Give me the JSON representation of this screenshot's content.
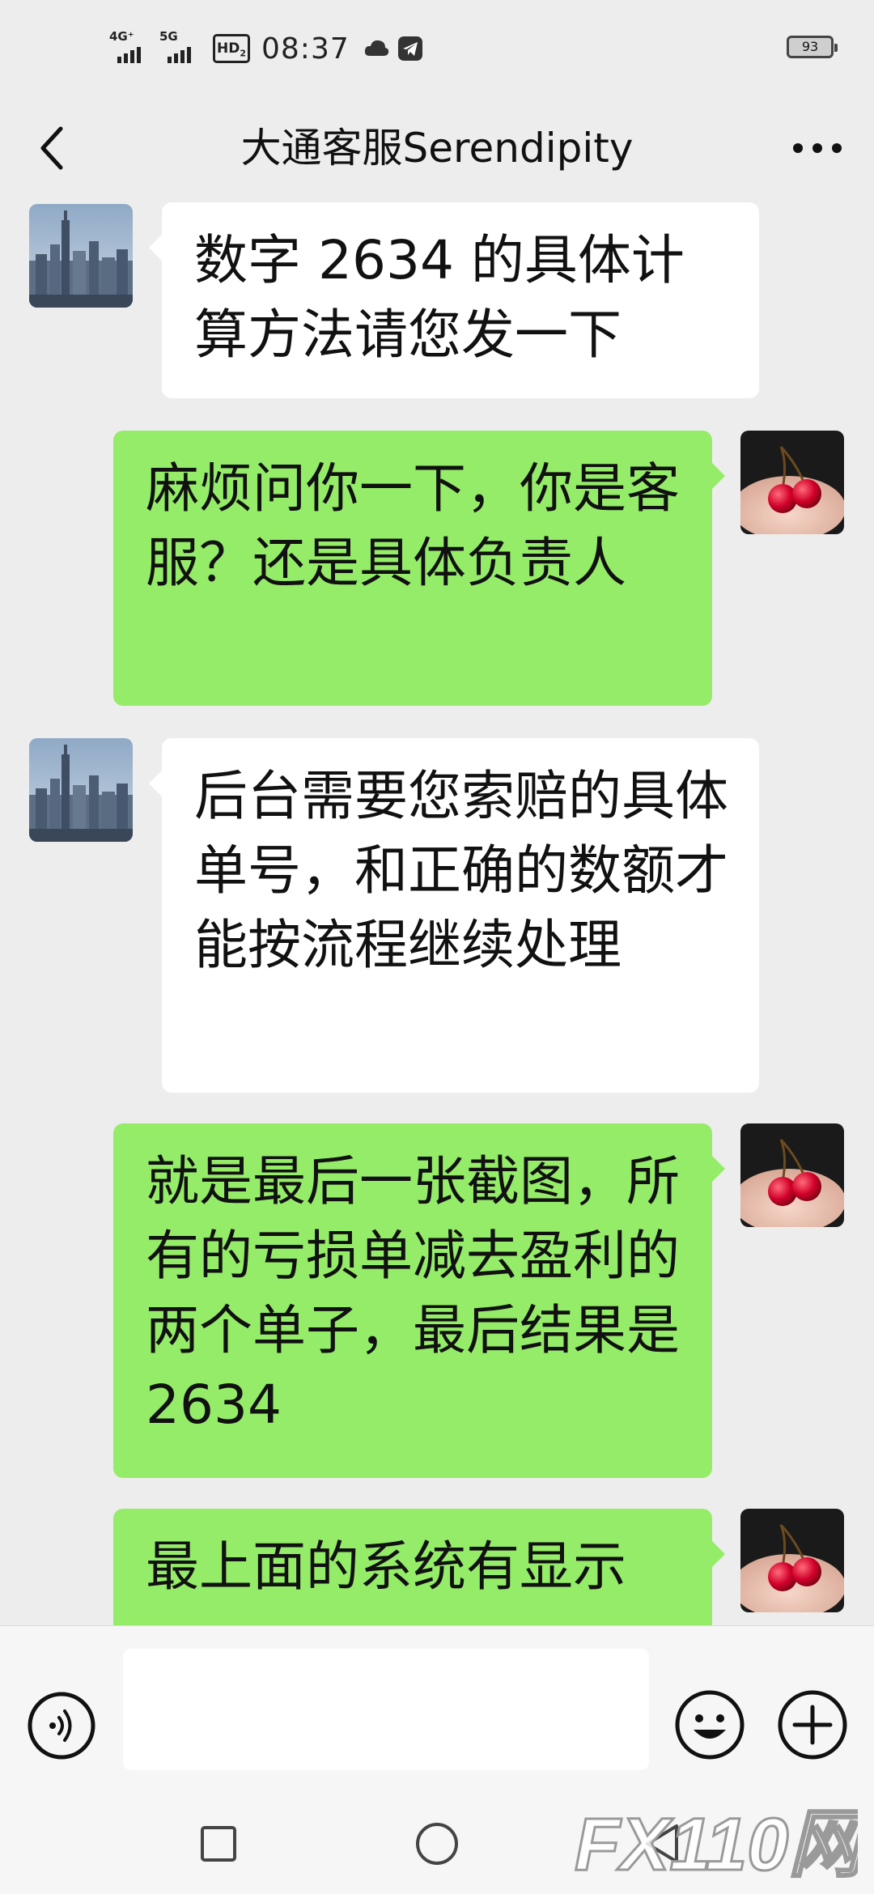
{
  "status_bar": {
    "network_1": "4G⁺",
    "network_2": "5G",
    "hd_label": "HD",
    "hd_sub": "2",
    "time": "08:37",
    "battery": "93"
  },
  "header": {
    "title": "大通客服Serendipity",
    "back_icon": "chevron-left-icon",
    "more_icon": "more-dots-icon"
  },
  "messages": [
    {
      "side": "left",
      "avatar": "city-skyline-avatar",
      "text": "数字 2634 的具体计算方法请您发一下"
    },
    {
      "side": "right",
      "avatar": "cherry-avatar",
      "text": "麻烦问你一下，你是客服？还是具体负责人"
    },
    {
      "side": "left",
      "avatar": "city-skyline-avatar",
      "text": "后台需要您索赔的具体单号，和正确的数额才能按流程继续处理"
    },
    {
      "side": "right",
      "avatar": "cherry-avatar",
      "text": "就是最后一张截图，所有的亏损单减去盈利的两个单子，最后结果是 2634"
    },
    {
      "side": "right",
      "avatar": "cherry-avatar",
      "text": "最上面的系统有显示"
    }
  ],
  "input_bar": {
    "placeholder": "",
    "voice_icon": "voice-icon",
    "emoji_icon": "emoji-icon",
    "plus_icon": "plus-icon"
  },
  "nav_bar": {
    "recents_icon": "square-icon",
    "home_icon": "circle-icon",
    "back_icon": "triangle-back-icon"
  },
  "watermark": {
    "text": "FX110网"
  },
  "colors": {
    "background": "#ededed",
    "my_bubble": "#95ec69",
    "their_bubble": "#ffffff",
    "text": "#111111"
  }
}
